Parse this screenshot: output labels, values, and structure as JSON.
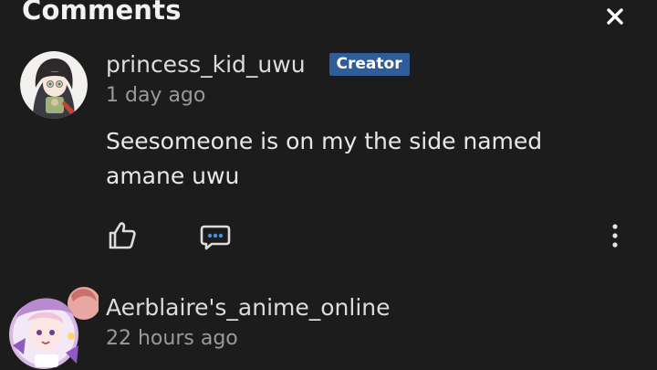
{
  "panel": {
    "title": "Comments",
    "close_icon": "close-icon"
  },
  "comments": [
    {
      "author": "princess_kid_uwu",
      "badge": "Creator",
      "timestamp": "1 day ago",
      "text": "Seesomeone is on my the side named amane uwu",
      "avatar_icon": "avatar",
      "actions": {
        "like_icon": "thumbs-up-icon",
        "reply_icon": "reply-bubble-icon",
        "more_icon": "more-vertical-icon"
      }
    },
    {
      "author": "Aerblaire's_anime_online",
      "timestamp": "22 hours ago",
      "avatar_icon": "avatar"
    }
  ],
  "colors": {
    "background": "#1c1c1c",
    "badge": "#2f5d99",
    "reply_dots": "#4a8fe7"
  }
}
